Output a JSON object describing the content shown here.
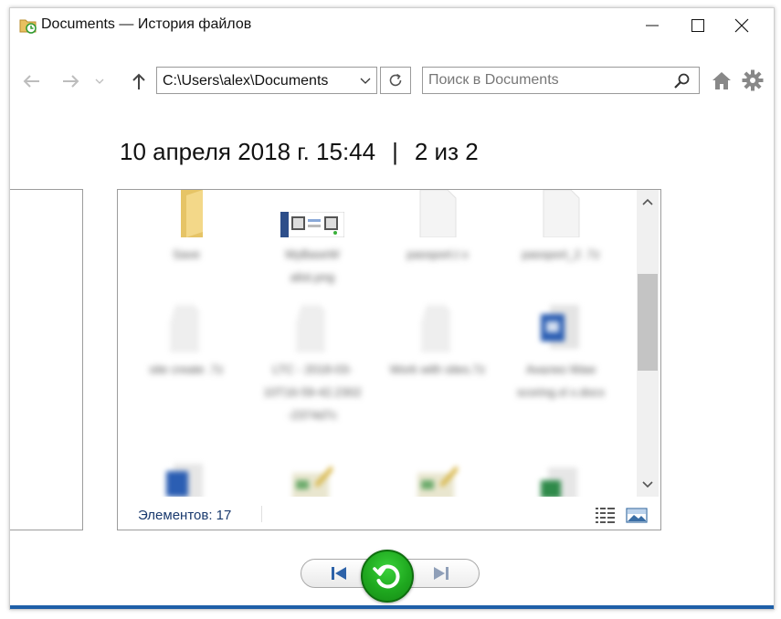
{
  "window": {
    "title": "Documents — История файлов"
  },
  "navbar": {
    "address": "C:\\Users\\alex\\Documents",
    "search_placeholder": "Поиск в Documents"
  },
  "info": {
    "datetime": "10 апреля 2018 г. 15:44",
    "separator": "|",
    "position": "2 из 2"
  },
  "files": [
    {
      "name": "Save",
      "icon": "folder-icon"
    },
    {
      "name": "MyBaseW alist.png",
      "icon": "image-thumbnail-icon"
    },
    {
      "name": "passport.t x",
      "icon": "blank-file-icon"
    },
    {
      "name": "passport_2 .7z",
      "icon": "blank-file-icon"
    },
    {
      "name": "site create .7z",
      "icon": "blank-file-icon"
    },
    {
      "name": "LTC - 2018-03-10T16-59-42.2302 -2374d7c",
      "icon": "blank-file-icon"
    },
    {
      "name": "Work with sites.7z",
      "icon": "blank-file-icon"
    },
    {
      "name": "Анализ Waw scoring.xl x.docx",
      "icon": "word-doc-icon"
    },
    {
      "name": "",
      "icon": "document-icon"
    },
    {
      "name": "",
      "icon": "edit-file-icon"
    },
    {
      "name": "",
      "icon": "edit-file-icon"
    },
    {
      "name": "",
      "icon": "excel-file-icon"
    }
  ],
  "status": {
    "item_count": "Элементов: 17"
  },
  "colors": {
    "restore_green": "#1fa81f",
    "status_text": "#1a3a6e",
    "accent_blue": "#1e5fa8"
  }
}
